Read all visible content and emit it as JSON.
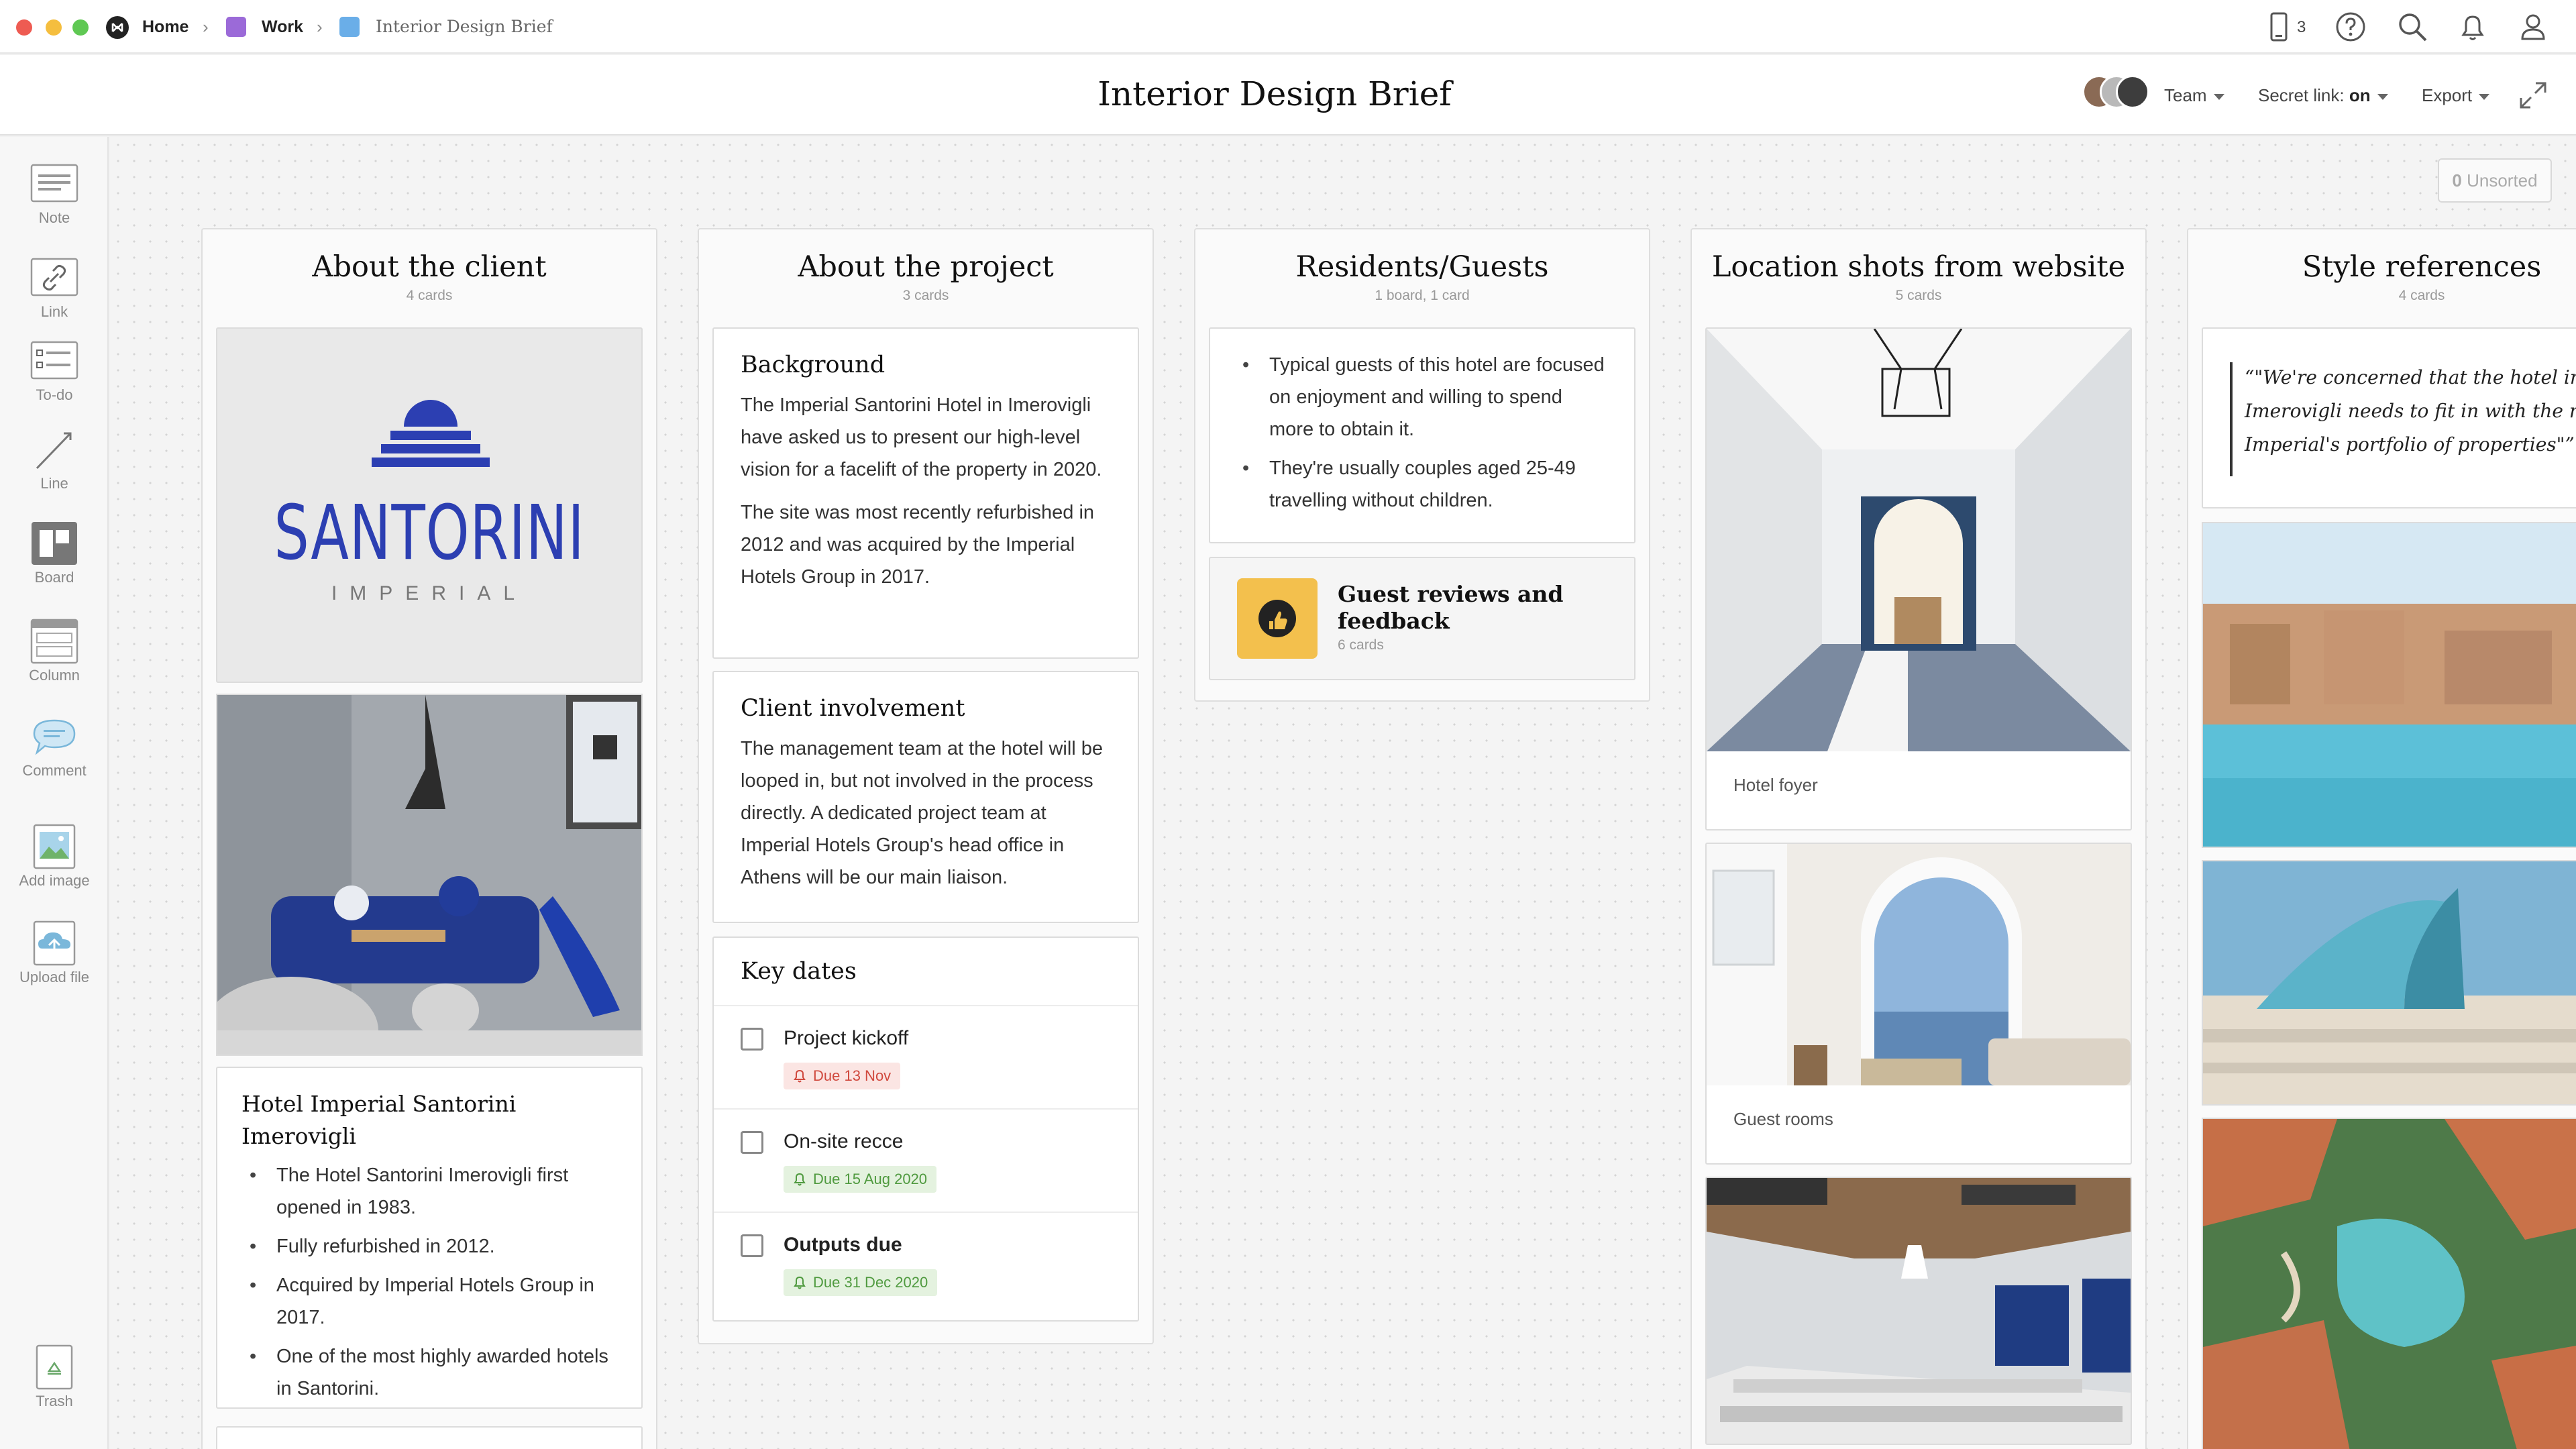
{
  "topbar": {
    "breadcrumbs": [
      {
        "label": "Home",
        "color": "#222222"
      },
      {
        "label": "Work",
        "color": "#9b6ad8"
      },
      {
        "label": "Interior Design Brief",
        "color": "#6aaee8"
      }
    ],
    "device_count": "3",
    "window_dots": [
      "#ee5b52",
      "#f5be3e",
      "#5fc853"
    ]
  },
  "header": {
    "title": "Interior Design Brief",
    "team_label": "Team",
    "secret_link_label": "Secret link: ",
    "secret_link_value": "on",
    "export_label": "Export"
  },
  "toolbar": {
    "items": [
      {
        "label": "Note",
        "icon": "note-icon"
      },
      {
        "label": "Link",
        "icon": "link-icon"
      },
      {
        "label": "To-do",
        "icon": "todo-icon"
      },
      {
        "label": "Line",
        "icon": "line-icon"
      },
      {
        "label": "Board",
        "icon": "board-icon"
      },
      {
        "label": "Column",
        "icon": "column-icon"
      },
      {
        "label": "Comment",
        "icon": "comment-icon"
      },
      {
        "label": "Add image",
        "icon": "image-icon"
      },
      {
        "label": "Upload file",
        "icon": "upload-icon"
      }
    ],
    "trash_label": "Trash"
  },
  "canvas": {
    "unsorted_count": "0",
    "unsorted_label": "Unsorted"
  },
  "columns": {
    "client": {
      "title": "About the client",
      "subtitle": "4 cards",
      "logo_word": "SANTORINI",
      "logo_sub": "IMPERIAL",
      "hotel_card": {
        "title": "Hotel Imperial Santorini Imerovigli",
        "bullets": [
          "The Hotel Santorini Imerovigli first opened in 1983.",
          "Fully refurbished in 2012.",
          "Acquired by Imperial Hotels Group in 2017.",
          "One of the most highly awarded hotels in Santorini."
        ]
      }
    },
    "project": {
      "title": "About the project",
      "subtitle": "3 cards",
      "background": {
        "title": "Background",
        "p1": "The Imperial Santorini Hotel in Imerovigli have asked us to present our high-level vision for a facelift of the property in 2020.",
        "p2": "The site was most recently refurbished in 2012 and was acquired by the Imperial Hotels Group in 2017."
      },
      "involvement": {
        "title": "Client involvement",
        "text": "The management team at the hotel will be looped in, but not involved in the process directly. A dedicated project team at Imperial Hotels Group's head office in Athens will be our main liaison."
      },
      "key_dates": {
        "title": "Key dates",
        "items": [
          {
            "label": "Project kickoff",
            "due": "Due 13 Nov",
            "status": "overdue",
            "checked": false
          },
          {
            "label": "On-site recce",
            "due": "Due 15 Aug 2020",
            "status": "upcoming",
            "checked": false
          },
          {
            "label": "Outputs due",
            "due": "Due 31 Dec 2020",
            "status": "upcoming",
            "checked": false
          }
        ]
      }
    },
    "residents": {
      "title": "Residents/Guests",
      "subtitle": "1 board, 1 card",
      "bullets": [
        "Typical guests of this hotel are focused on enjoyment and willing to spend more to obtain it.",
        "They're usually couples aged 25-49 travelling without children."
      ],
      "board_link": {
        "title": "Guest reviews and feedback",
        "count": "6 cards",
        "icon": "thumbs-up-icon",
        "color": "#f3c04d"
      }
    },
    "location": {
      "title": "Location shots from website",
      "subtitle": "5 cards",
      "captions": [
        "Hotel foyer",
        "Guest rooms"
      ]
    },
    "style": {
      "title": "Style references",
      "subtitle": "4 cards",
      "quote": "“\"We're concerned that the hotel in Imerovigli needs to fit in with the rest Imperial's portfolio of properties\"”"
    }
  },
  "colors": {
    "logo_blue": "#2c3fb2",
    "overdue_bg": "#fbe5e3",
    "overdue_text": "#d0493e",
    "upcoming_bg": "#e4f2df",
    "upcoming_text": "#4f9a3f"
  }
}
